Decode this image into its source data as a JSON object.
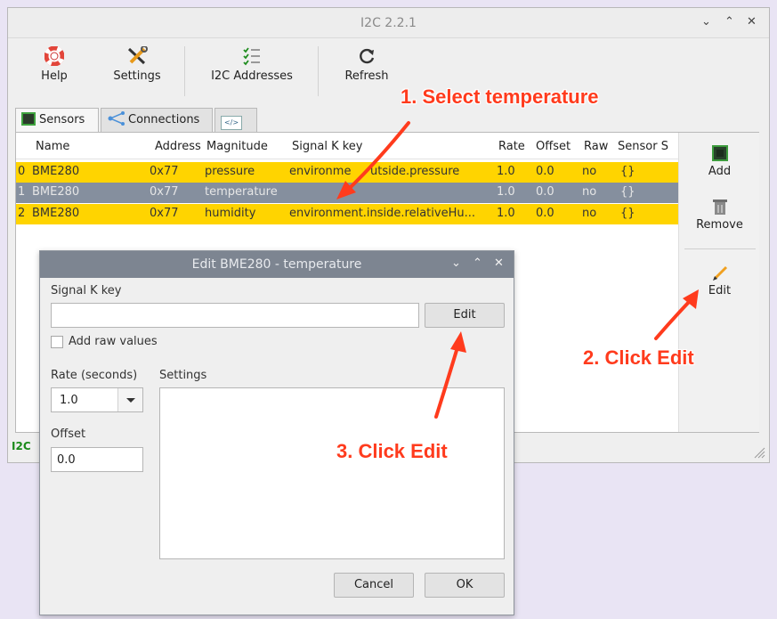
{
  "window": {
    "title": "I2C 2.2.1"
  },
  "toolbar": {
    "help": "Help",
    "settings": "Settings",
    "addresses": "I2C Addresses",
    "refresh": "Refresh"
  },
  "tabs": {
    "sensors": "Sensors",
    "connections": "Connections"
  },
  "table": {
    "headers": [
      "Name",
      "Address",
      "Magnitude",
      "Signal K key",
      "Rate",
      "Offset",
      "Raw",
      "Sensor S"
    ],
    "rows": [
      {
        "idx": "0",
        "name": "BME280",
        "address": "0x77",
        "magnitude": "pressure",
        "sk_a": "environme",
        "sk_b": "utside.pressure",
        "rate": "1.0",
        "offset": "0.0",
        "raw": "no",
        "settings": "{}"
      },
      {
        "idx": "1",
        "name": "BME280",
        "address": "0x77",
        "magnitude": "temperature",
        "sk": "",
        "rate": "1.0",
        "offset": "0.0",
        "raw": "no",
        "settings": "{}"
      },
      {
        "idx": "2",
        "name": "BME280",
        "address": "0x77",
        "magnitude": "humidity",
        "sk": "environment.inside.relativeHu...",
        "rate": "1.0",
        "offset": "0.0",
        "raw": "no",
        "settings": "{}"
      }
    ]
  },
  "side": {
    "add": "Add",
    "remove": "Remove",
    "edit": "Edit"
  },
  "status": {
    "label": "I2C"
  },
  "dialog": {
    "title": "Edit BME280 - temperature",
    "signalk_label": "Signal K key",
    "signalk_value": "",
    "edit_button": "Edit",
    "raw_label": "Add raw values",
    "rate_label": "Rate (seconds)",
    "rate_value": "1.0",
    "settings_label": "Settings",
    "offset_label": "Offset",
    "offset_value": "0.0",
    "cancel": "Cancel",
    "ok": "OK"
  },
  "annotations": {
    "step1": "1. Select temperature",
    "step2": "2. Click Edit",
    "step3": "3. Click Edit"
  },
  "colors": {
    "highlight_row": "#ffd400",
    "selected_row": "#858f9e",
    "annotation": "#ff3b1d",
    "status_green": "#1b8a1b"
  }
}
